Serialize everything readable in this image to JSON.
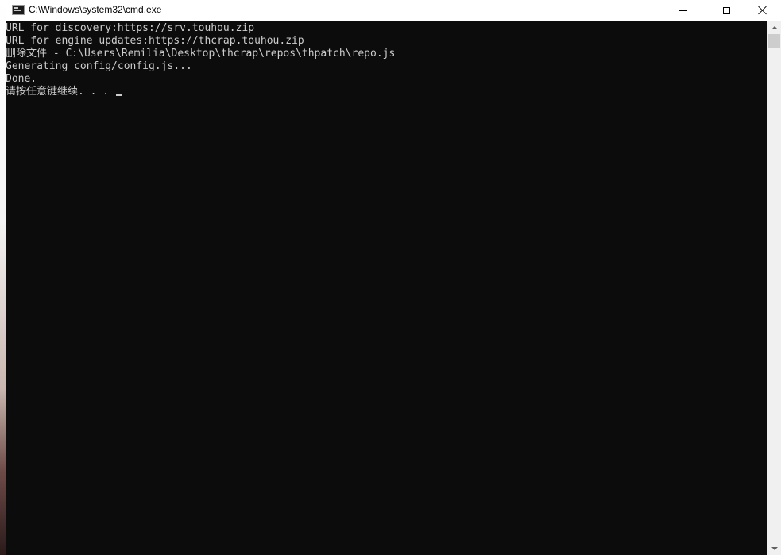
{
  "window": {
    "title": "C:\\Windows\\system32\\cmd.exe",
    "icon": "console-icon"
  },
  "titlebar_buttons": {
    "minimize": "minimize-icon",
    "maximize": "maximize-icon",
    "close": "close-icon"
  },
  "console": {
    "text_color": "#cccccc",
    "background": "#0c0c0c",
    "lines": [
      "URL for discovery:https://srv.touhou.zip",
      "URL for engine updates:https://thcrap.touhou.zip",
      "删除文件 - C:\\Users\\Remilia\\Desktop\\thcrap\\repos\\thpatch\\repo.js",
      "Generating config/config.js...",
      "Done.",
      "请按任意键继续. . . "
    ]
  }
}
